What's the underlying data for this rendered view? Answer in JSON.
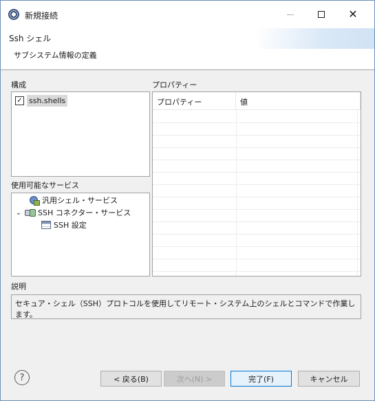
{
  "window": {
    "title": "新規接続",
    "controls": {
      "minimize": "minimize-icon",
      "maximize": "maximize-icon",
      "close": "close-icon"
    }
  },
  "wizard": {
    "title": "Ssh シェル",
    "message": "サブシステム情報の定義"
  },
  "config": {
    "label": "構成",
    "items": [
      {
        "label": "ssh.shells",
        "checked": true
      }
    ]
  },
  "properties": {
    "label": "プロパティー",
    "columns": [
      "プロパティー",
      "値"
    ],
    "rows": []
  },
  "services": {
    "label": "使用可能なサービス",
    "tree": [
      {
        "label": "汎用シェル・サービス",
        "icon": "generic-service-icon"
      },
      {
        "label": "SSH コネクター・サービス",
        "icon": "ssh-connector-icon",
        "expanded": true,
        "children": [
          {
            "label": "SSH 設定",
            "icon": "settings-table-icon"
          }
        ]
      }
    ]
  },
  "description": {
    "label": "説明",
    "text": "セキュア・シェル（SSH）プロトコルを使用してリモート・システム上のシェルとコマンドで作業します。"
  },
  "buttons": {
    "help": "?",
    "back": "< 戻る(B)",
    "next": "次へ(N) >",
    "finish": "完了(F)",
    "cancel": "キャンセル"
  }
}
